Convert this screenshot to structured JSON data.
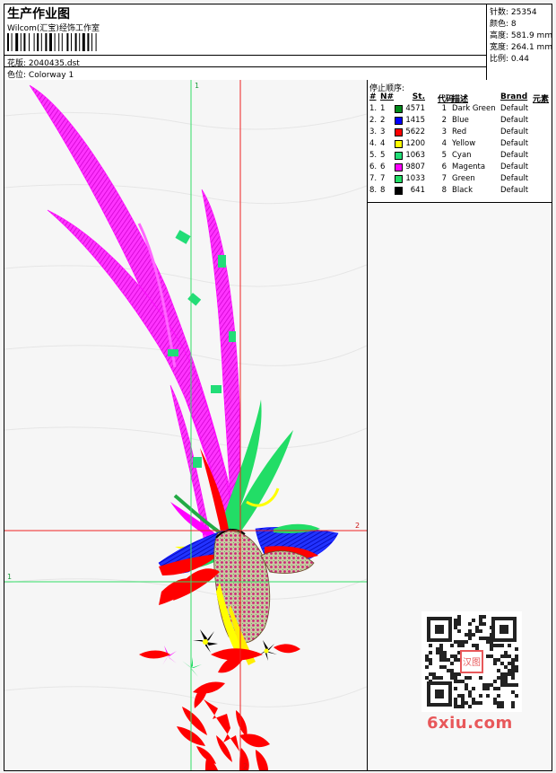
{
  "header": {
    "title": "生产作业图",
    "company": "Wilcom(汇宝)经饰工作室",
    "design_label": "花版:",
    "design_value": "2040435.dst",
    "colorway_label": "色位:",
    "colorway_value": "Colorway 1"
  },
  "stats": [
    {
      "label": "针数:",
      "value": "25354"
    },
    {
      "label": "颜色:",
      "value": "8"
    },
    {
      "label": "高度:",
      "value": "581.9 mm"
    },
    {
      "label": "宽度:",
      "value": "264.1 mm"
    },
    {
      "label": "比例:",
      "value": "0.44"
    }
  ],
  "stop_sequence": {
    "title": "停止顺序:",
    "columns": [
      "#",
      "N#",
      "St.",
      "代码",
      "描述",
      "Brand",
      "元素"
    ],
    "rows": [
      {
        "idx": "1.",
        "n": "1",
        "color": "#008a1c",
        "st": "4571",
        "code": "1",
        "desc": "Dark Green",
        "brand": "Default"
      },
      {
        "idx": "2.",
        "n": "2",
        "color": "#0000ff",
        "st": "1415",
        "code": "2",
        "desc": "Blue",
        "brand": "Default"
      },
      {
        "idx": "3.",
        "n": "3",
        "color": "#ff0000",
        "st": "5622",
        "code": "3",
        "desc": "Red",
        "brand": "Default"
      },
      {
        "idx": "4.",
        "n": "4",
        "color": "#ffff00",
        "st": "1200",
        "code": "4",
        "desc": "Yellow",
        "brand": "Default"
      },
      {
        "idx": "5.",
        "n": "5",
        "color": "#22dd77",
        "st": "1063",
        "code": "5",
        "desc": "Cyan",
        "brand": "Default"
      },
      {
        "idx": "6.",
        "n": "6",
        "color": "#ff00ff",
        "st": "9807",
        "code": "6",
        "desc": "Magenta",
        "brand": "Default"
      },
      {
        "idx": "7.",
        "n": "7",
        "color": "#22dd66",
        "st": "1033",
        "code": "7",
        "desc": "Green",
        "brand": "Default"
      },
      {
        "idx": "8.",
        "n": "8",
        "color": "#000000",
        "st": "641",
        "code": "8",
        "desc": "Black",
        "brand": "Default"
      }
    ]
  },
  "guides": {
    "v1_label": "1",
    "v2_label": "2",
    "h1_label": "1",
    "h2_label": "2",
    "green_color": "#33dd66",
    "red_color": "#ee2222"
  },
  "watermark": {
    "site": "6xiu.com",
    "stamp": "汉图",
    "stamp_color": "#e8585a"
  }
}
